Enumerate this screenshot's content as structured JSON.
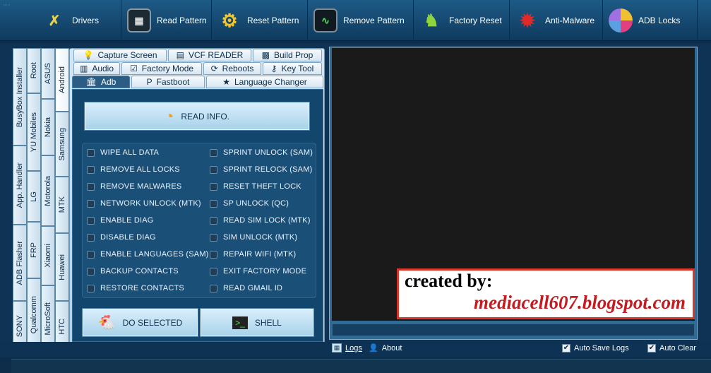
{
  "toolbar": {
    "items": [
      {
        "label": "Drivers",
        "icon": "tools-icon"
      },
      {
        "label": "Read Pattern",
        "icon": "pattern-icon"
      },
      {
        "label": "Reset Pattern",
        "icon": "gear-icon"
      },
      {
        "label": "Remove Pattern",
        "icon": "monitor-icon"
      },
      {
        "label": "Factory Reset",
        "icon": "android-icon"
      },
      {
        "label": "Anti-Malware",
        "icon": "virus-icon"
      },
      {
        "label": "ADB Locks",
        "icon": "pie-chart-icon"
      }
    ]
  },
  "side_tabs": {
    "col1": [
      "BusyBox Installer",
      "App. Handler",
      "ADB Flasher",
      "SONY"
    ],
    "col2": [
      "Root",
      "YU Mobiles",
      "LG",
      "FRP",
      "Qualcomm"
    ],
    "col3": [
      "ASUS",
      "Nokia",
      "Motorola",
      "Xiaomi",
      "MicroSoft"
    ],
    "col4": [
      "Android",
      "Samsung",
      "MTK",
      "Huawei",
      "HTC"
    ]
  },
  "tabs": {
    "row1": [
      "Capture Screen",
      "VCF READER",
      "Build Prop"
    ],
    "row2": [
      "Audio",
      "Factory Mode",
      "Reboots",
      "Key Tool"
    ],
    "row3": [
      "Adb",
      "Fastboot",
      "Language Changer"
    ],
    "selected": "Adb"
  },
  "read_info": "READ INFO.",
  "options_left": [
    "WIPE ALL DATA",
    "REMOVE ALL LOCKS",
    "REMOVE MALWARES",
    "NETWORK UNLOCK (MTK)",
    "ENABLE DIAG",
    "DISABLE DIAG",
    "ENABLE LANGUAGES (SAM)",
    "BACKUP CONTACTS",
    "RESTORE CONTACTS"
  ],
  "options_right": [
    "SPRINT UNLOCK (SAM)",
    "SPRINT RELOCK (SAM)",
    "RESET THEFT LOCK",
    "SP UNLOCK (QC)",
    "READ SIM LOCK (MTK)",
    "SIM UNLOCK (MTK)",
    "REPAIR WIFI (MTK)",
    "EXIT FACTORY MODE",
    "READ GMAIL ID"
  ],
  "do_selected": "DO SELECTED",
  "shell": "SHELL",
  "watermark": {
    "line1": "created by:",
    "line2": "mediacell607.blogspot.com"
  },
  "bottom": {
    "logs": "Logs",
    "about": "About",
    "auto_save": "Auto Save Logs",
    "auto_clear": "Auto Clear",
    "auto_save_checked": true,
    "auto_clear_checked": true
  },
  "colors": {
    "accent": "#1d5a86",
    "log_bg": "#1a1a1a",
    "watermark_red": "#c41b20"
  }
}
